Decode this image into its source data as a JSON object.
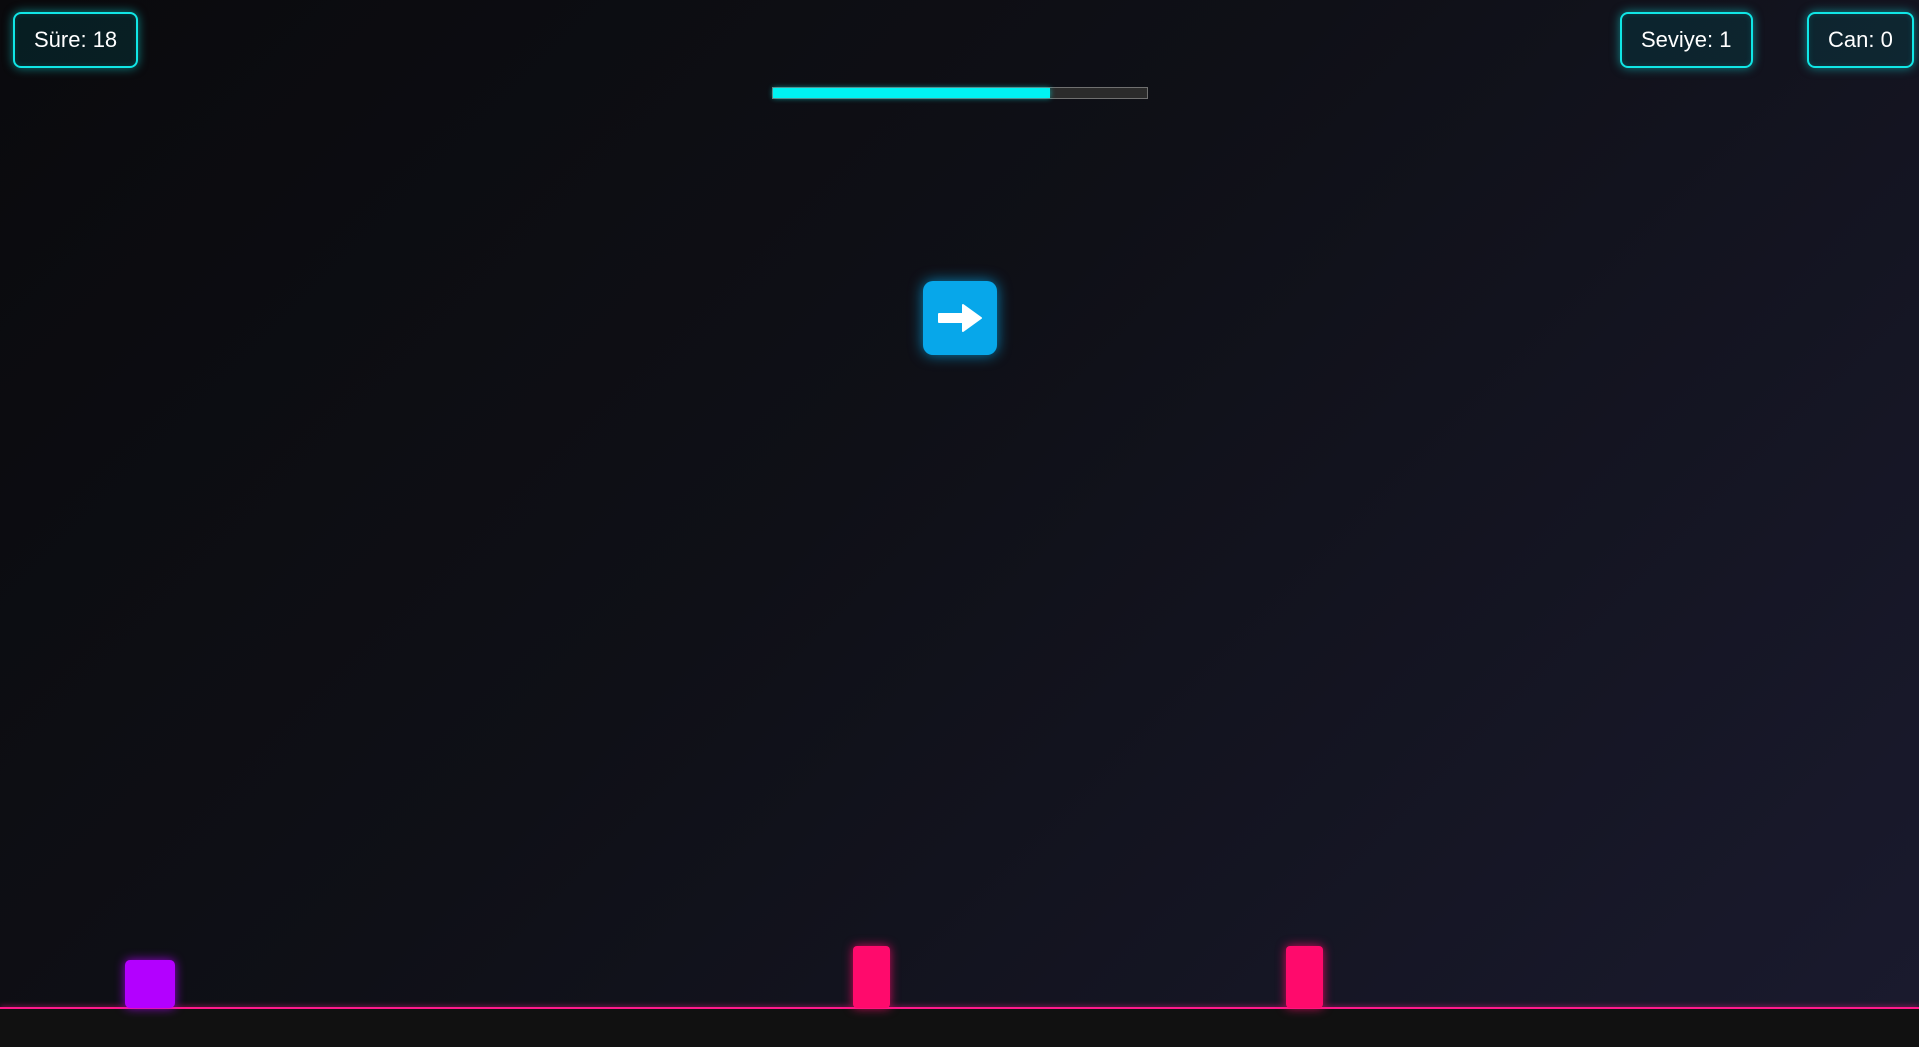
{
  "hud": {
    "time_text": "Süre: 18",
    "level_text": "Seviye: 1",
    "lives_text": "Can: 0"
  },
  "progress": {
    "value_percent": 74,
    "color": "#00f2f2"
  },
  "direction_prompt": {
    "icon": "arrow-right-icon",
    "direction": "right",
    "color": "#07a7ea"
  },
  "entities": {
    "player": {
      "color": "#b300ff"
    },
    "obstacles": [
      {
        "color": "#ff0a6c"
      },
      {
        "color": "#ff0a6c"
      }
    ]
  },
  "theme": {
    "accent": "#10e6e6",
    "ground_line": "#ff1a8c"
  }
}
